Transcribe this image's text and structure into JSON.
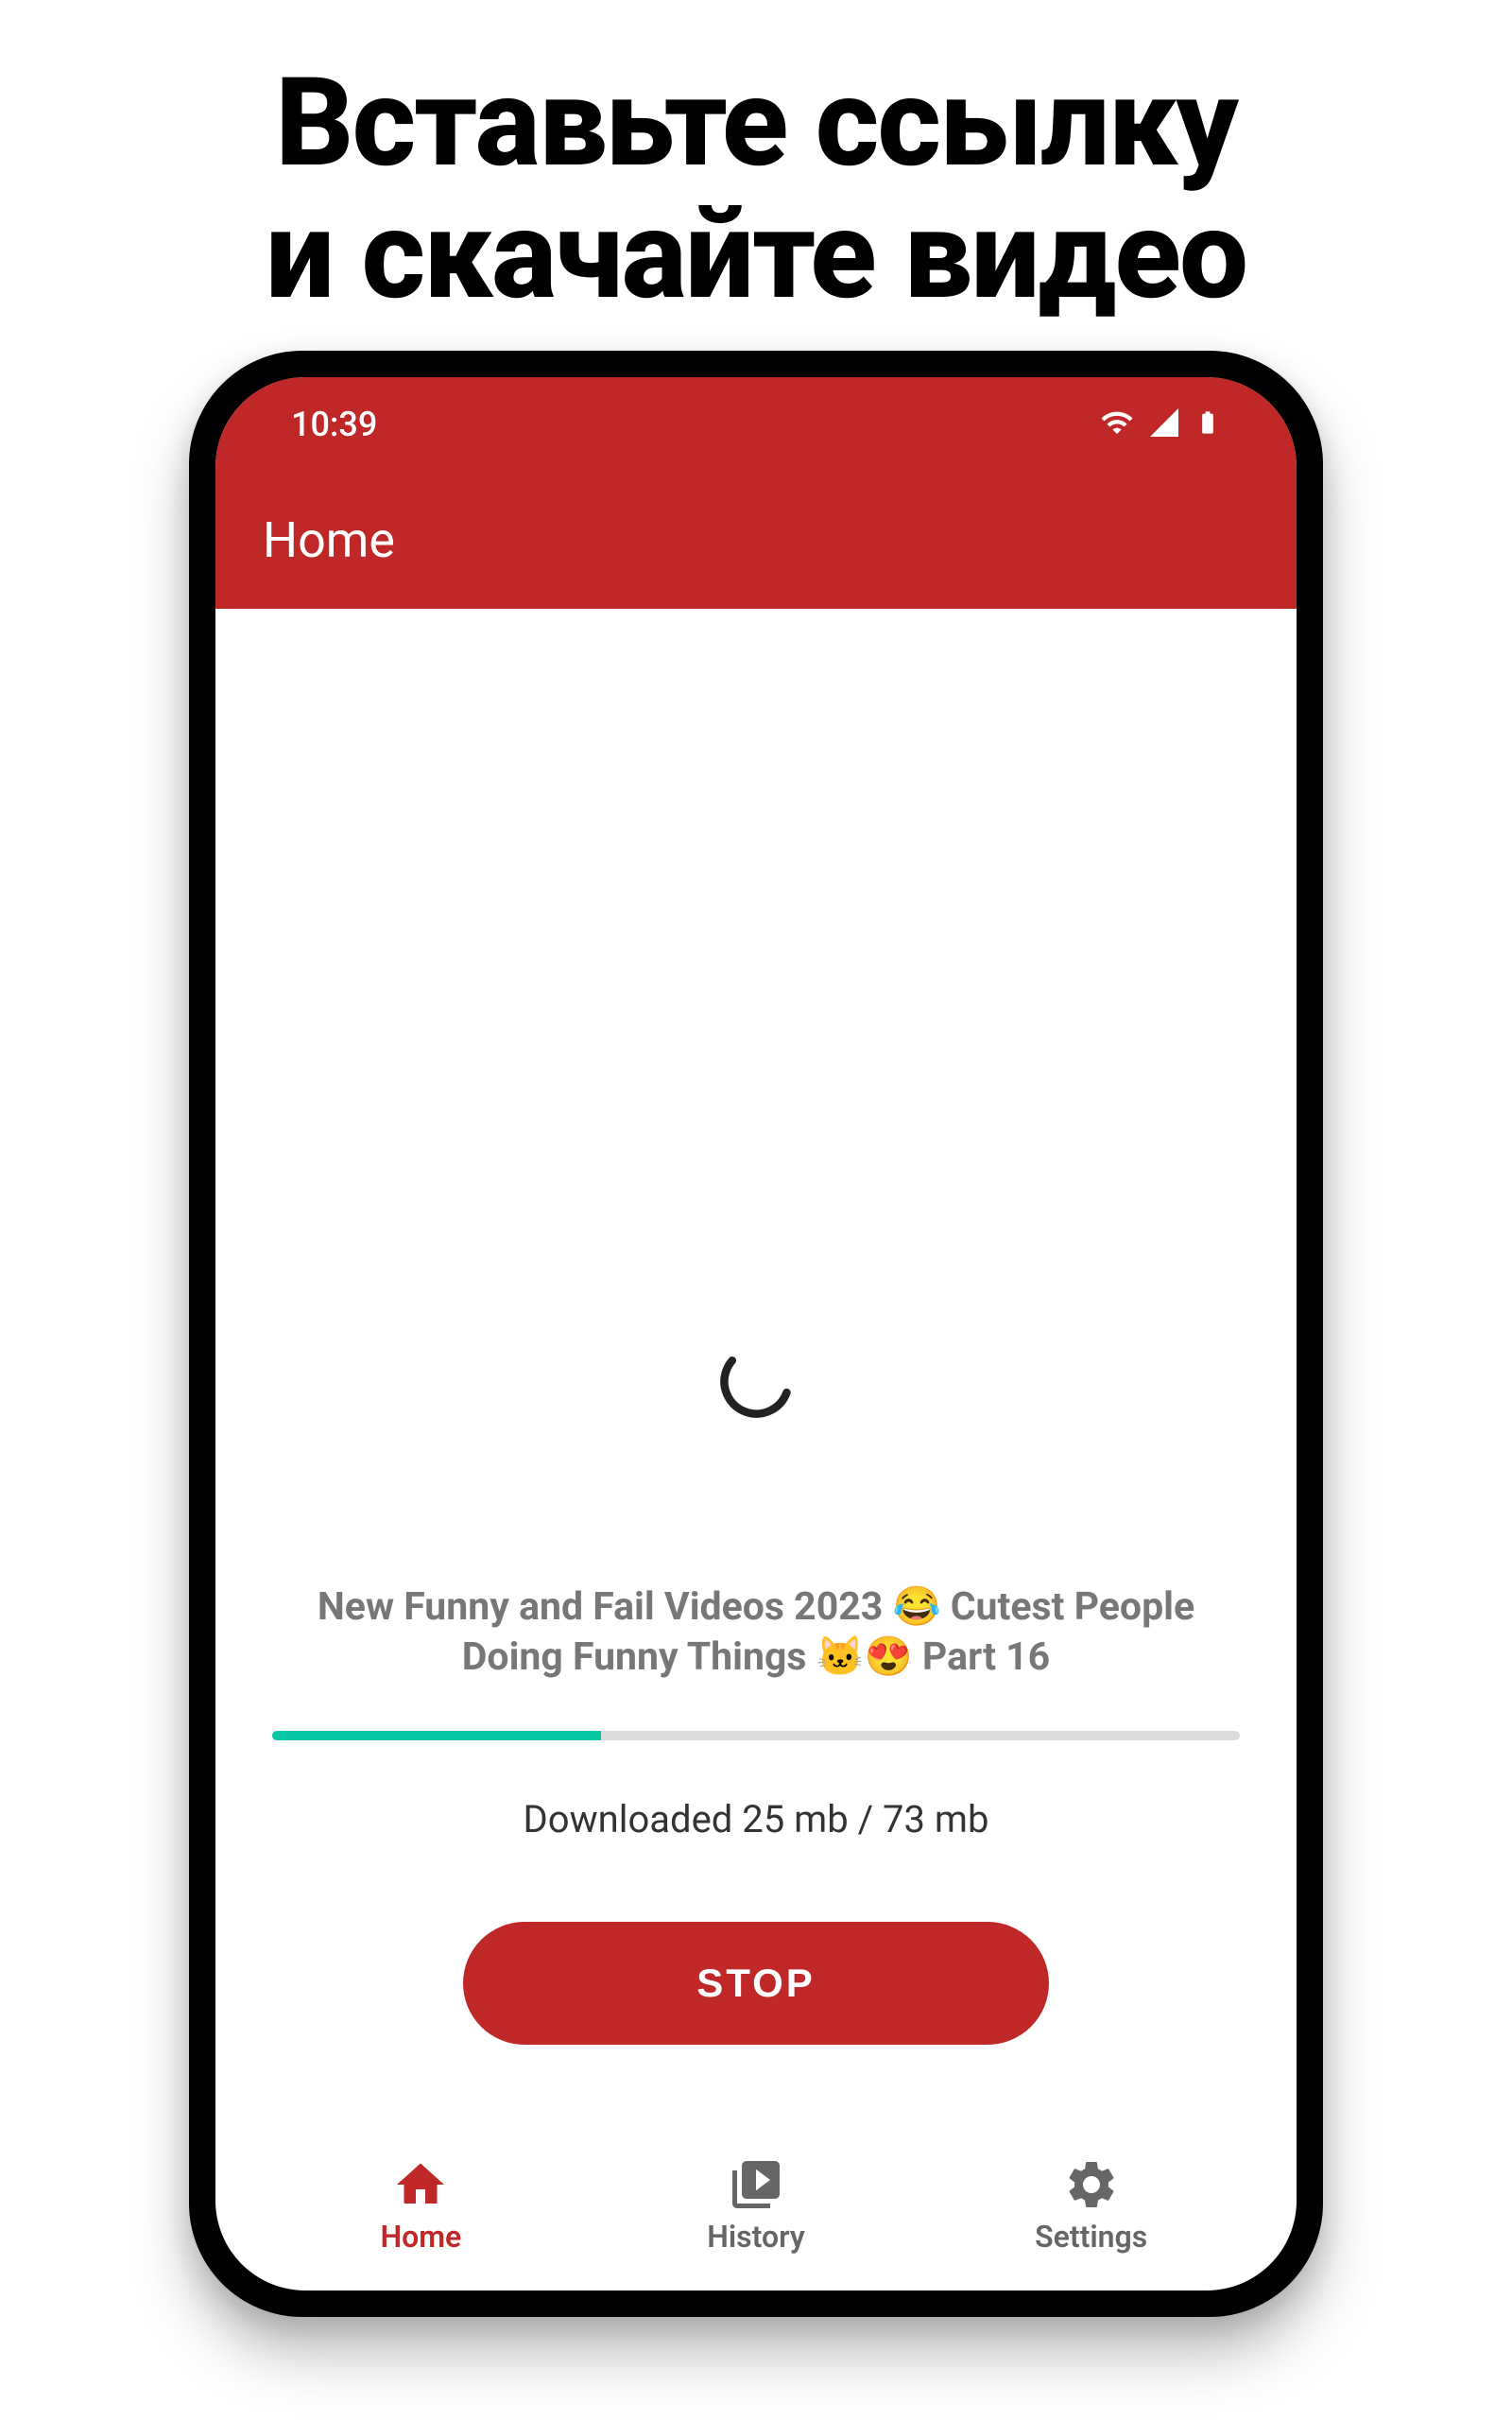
{
  "promo": {
    "line1": "Вставьте ссылку",
    "line2": "и скачайте видео"
  },
  "status_bar": {
    "time": "10:39"
  },
  "app_bar": {
    "title": "Home"
  },
  "download": {
    "video_title": "New Funny and Fail Videos 2023 😂 Cutest People Doing Funny Things 🐱😍 Part 16",
    "progress_percent": 34,
    "downloaded_mb": 25,
    "total_mb": 73,
    "status_text": "Downloaded 25 mb / 73 mb",
    "stop_label": "STOP"
  },
  "nav": {
    "items": [
      {
        "label": "Home",
        "active": true
      },
      {
        "label": "History",
        "active": false
      },
      {
        "label": "Settings",
        "active": false
      }
    ]
  },
  "colors": {
    "accent": "#c02828",
    "progress": "#06c6a4"
  }
}
